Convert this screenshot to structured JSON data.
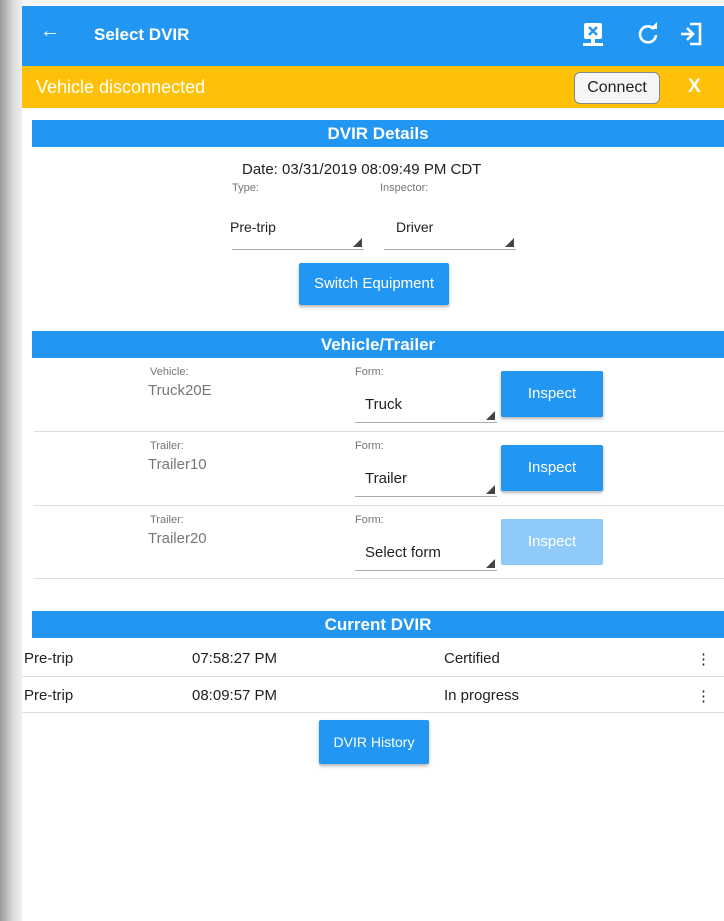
{
  "topbar": {
    "title": "Select DVIR",
    "icons": [
      "back-arrow-icon",
      "disconnect-device-icon",
      "refresh-icon",
      "logout-icon"
    ]
  },
  "alert": {
    "text": "Vehicle disconnected",
    "connect_label": "Connect",
    "close_label": "X"
  },
  "details": {
    "header": "DVIR Details",
    "date": "Date: 03/31/2019 08:09:49 PM CDT",
    "type_label": "Type:",
    "type_value": "Pre-trip",
    "inspector_label": "Inspector:",
    "inspector_value": "Driver",
    "switch_label": "Switch Equipment"
  },
  "equipment": {
    "header": "Vehicle/Trailer",
    "rows": [
      {
        "kind_label": "Vehicle:",
        "name": "Truck20E",
        "form_label": "Form:",
        "form_value": "Truck",
        "inspect_label": "Inspect"
      },
      {
        "kind_label": "Trailer:",
        "name": "Trailer10",
        "form_label": "Form:",
        "form_value": "Trailer",
        "inspect_label": "Inspect"
      },
      {
        "kind_label": "Trailer:",
        "name": "Trailer20",
        "form_label": "Form:",
        "form_value": "Select form",
        "inspect_label": "Inspect"
      }
    ]
  },
  "current": {
    "header": "Current DVIR",
    "rows": [
      {
        "type": "Pre-trip",
        "time": "07:58:27 PM",
        "status": "Certified"
      },
      {
        "type": "Pre-trip",
        "time": "08:09:57 PM",
        "status": "In progress"
      }
    ],
    "history_label": "DVIR History"
  },
  "colors": {
    "primary": "#2196f3",
    "warning": "#ffc107",
    "disabled": "#90caf9"
  }
}
